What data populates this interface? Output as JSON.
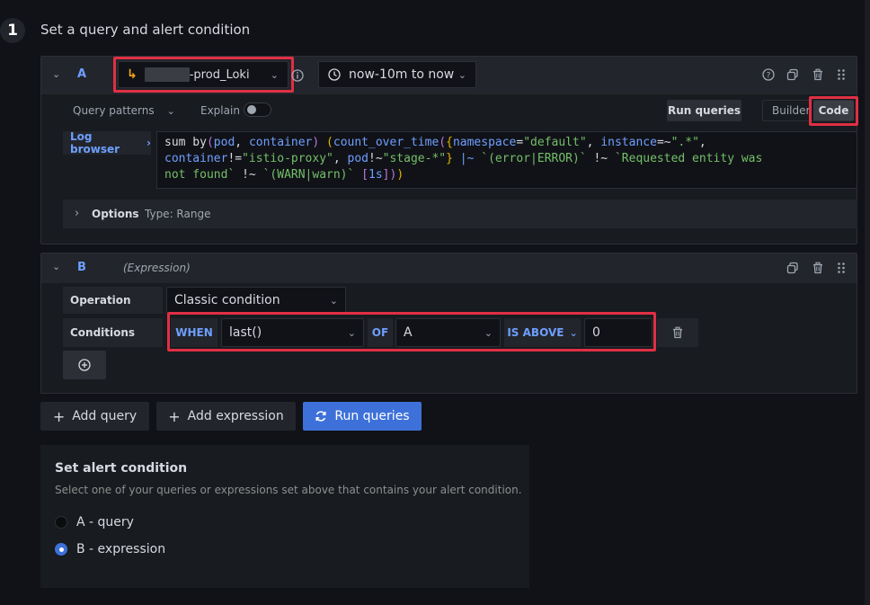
{
  "step": {
    "number": "1",
    "title": "Set a query and alert condition"
  },
  "query_a": {
    "letter": "A",
    "datasource": "-prod_Loki",
    "time_range": "now-10m to now",
    "query_patterns": "Query patterns",
    "explain": "Explain",
    "run_queries": "Run queries",
    "builder": "Builder",
    "code": "Code",
    "log_browser": "Log browser",
    "options_label": "Options",
    "options_type": "Type: Range"
  },
  "expression_b": {
    "letter": "B",
    "subtitle": "(Expression)",
    "operation_label": "Operation",
    "operation_value": "Classic condition",
    "conditions_label": "Conditions",
    "when": "WHEN",
    "reducer": "last()",
    "of": "OF",
    "query_ref": "A",
    "evaluator": "IS ABOVE",
    "threshold": "0"
  },
  "actions": {
    "add_query": "Add query",
    "add_expression": "Add expression",
    "run_queries": "Run queries"
  },
  "alert_condition": {
    "title": "Set alert condition",
    "description": "Select one of your queries or expressions set above that contains your alert condition.",
    "options": [
      {
        "label": "A - query",
        "selected": false
      },
      {
        "label": "B - expression",
        "selected": true
      }
    ]
  },
  "colors": {
    "accent": "#3d71d9",
    "highlight_border": "#e02f44",
    "background": "#111217"
  }
}
